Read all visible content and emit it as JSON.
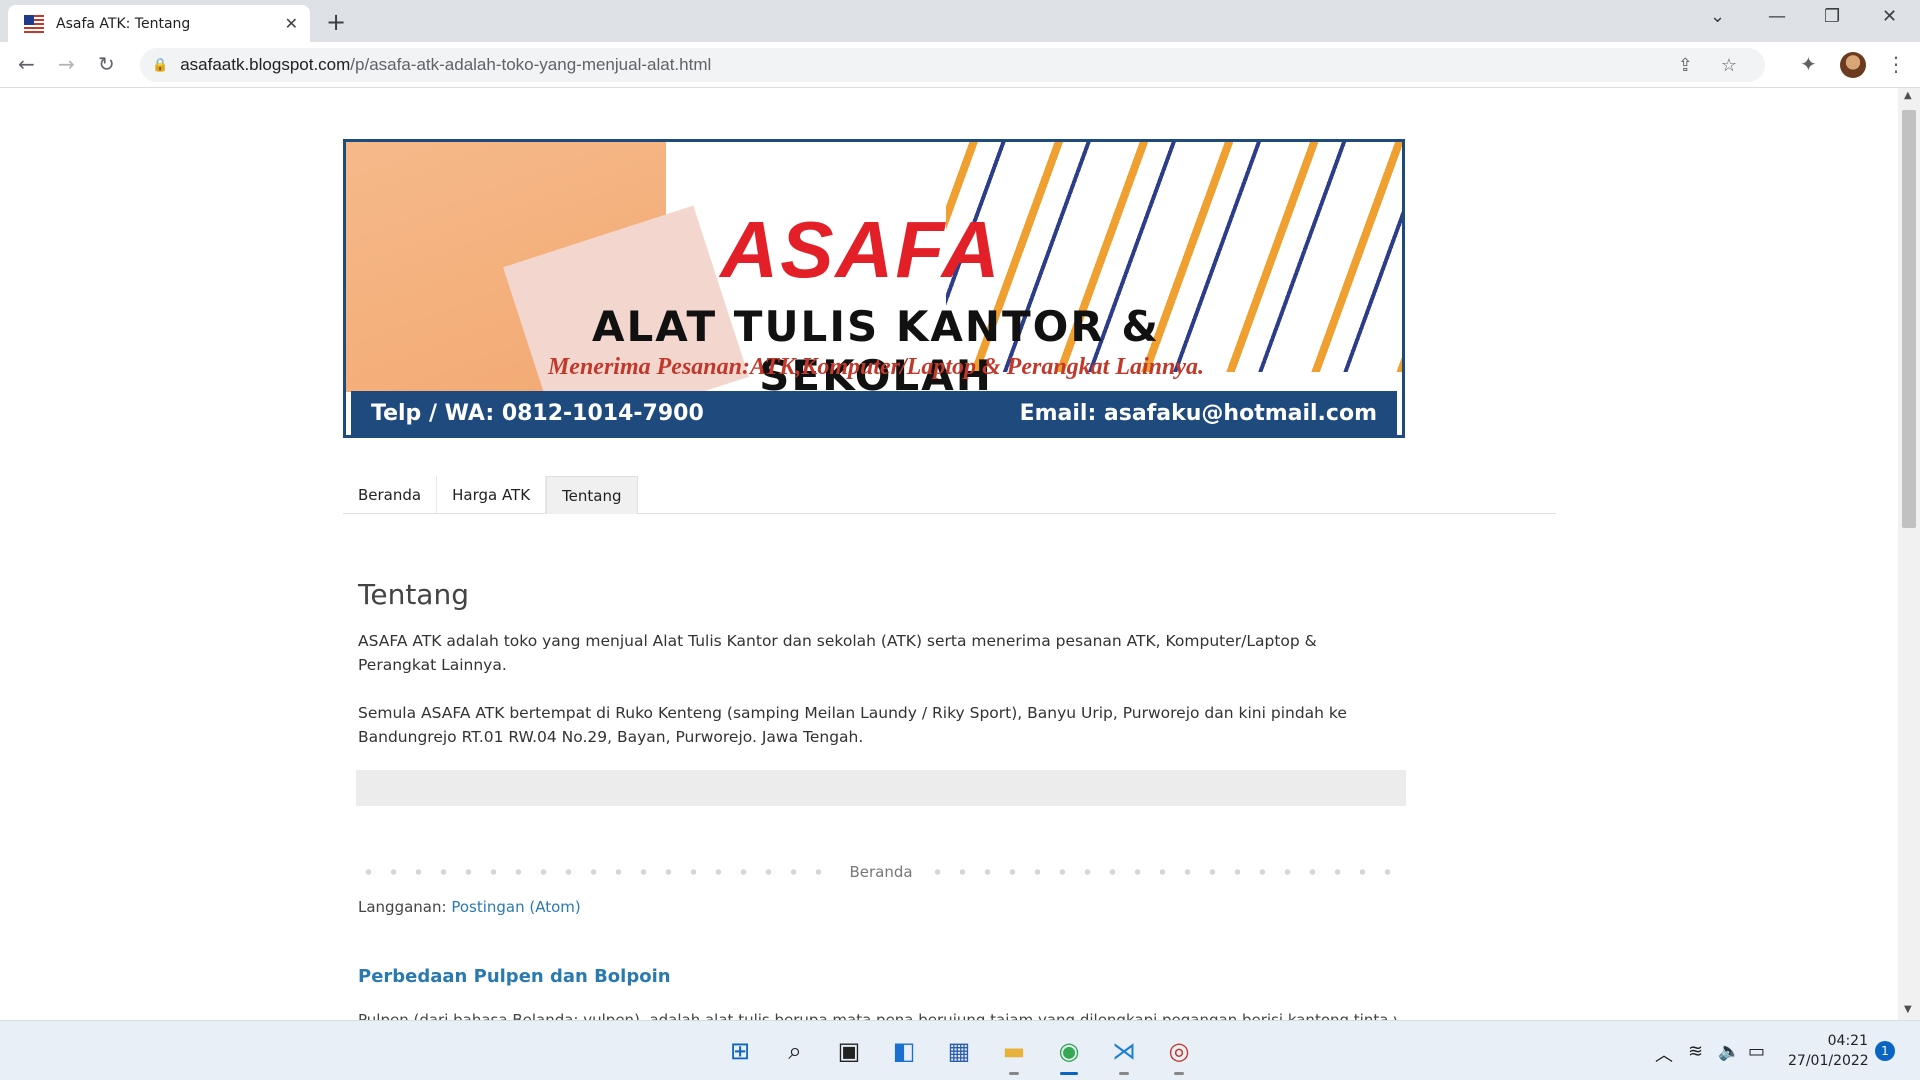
{
  "browser": {
    "tab_title": "Asafa ATK: Tentang",
    "url_host": "asafaatk.blogspot.com",
    "url_path": "/p/asafa-atk-adalah-toko-yang-menjual-alat.html"
  },
  "banner": {
    "brand": "ASAFA",
    "line1": "ALAT TULIS KANTOR & SEKOLAH",
    "line2": "Menerima Pesanan:ATK,Komputer/Laptop & Perangkat Lainnya.",
    "phone": "Telp / WA: 0812-1014-7900",
    "email": "Email: asafaku@hotmail.com"
  },
  "nav": {
    "items": [
      {
        "label": "Beranda"
      },
      {
        "label": "Harga ATK"
      },
      {
        "label": "Tentang"
      }
    ]
  },
  "post": {
    "title": "Tentang",
    "p1": "ASAFA ATK adalah toko yang menjual Alat Tulis Kantor dan sekolah (ATK) serta menerima pesanan ATK, Komputer/Laptop & Perangkat Lainnya.",
    "p2": "Semula ASAFA ATK bertempat di Ruko Kenteng (samping Meilan Laundy / Riky Sport), Banyu Urip, Purworejo dan kini pindah ke Bandungrejo RT.01 RW.04 No.29, Bayan, Purworejo. Jawa Tengah."
  },
  "footer": {
    "home_link": "Beranda",
    "subscribe_label": "Langganan:",
    "subscribe_link": "Postingan (Atom)",
    "related_title": "Perbedaan Pulpen dan Bolpoin",
    "related_snippet": "Pulpen (dari bahasa Belanda: vulpen), adalah alat tulis berupa mata pena berujung tajam yang dilengkapi pegangan berisi kantong tinta yan"
  },
  "taskbar": {
    "time": "04:21",
    "date": "27/01/2022",
    "notification_count": "1"
  }
}
